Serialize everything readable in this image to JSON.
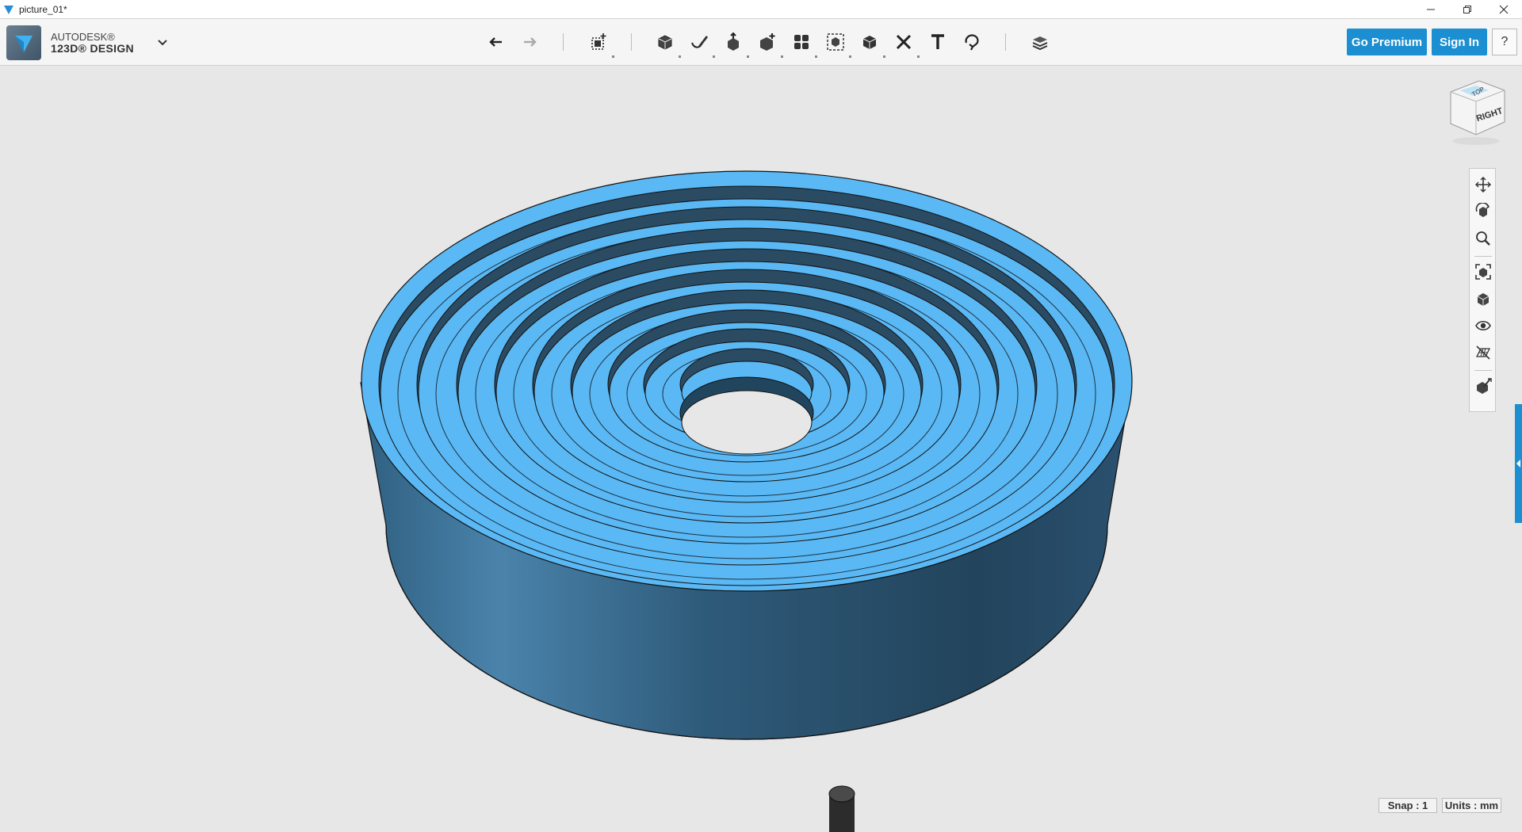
{
  "window": {
    "title": "picture_01*",
    "controls": [
      "minimize",
      "restore",
      "close"
    ]
  },
  "brand": {
    "line1": "AUTODESK®",
    "line2": "123D® DESIGN"
  },
  "toolbar": {
    "tools": [
      {
        "name": "undo-icon"
      },
      {
        "name": "redo-icon"
      },
      {
        "name": "transform-icon"
      },
      {
        "name": "primitives-icon"
      },
      {
        "name": "sketch-icon"
      },
      {
        "name": "construct-icon"
      },
      {
        "name": "modify-icon"
      },
      {
        "name": "pattern-icon"
      },
      {
        "name": "grouping-icon"
      },
      {
        "name": "combine-icon"
      },
      {
        "name": "measure-icon"
      },
      {
        "name": "text-icon"
      },
      {
        "name": "snap-icon"
      },
      {
        "name": "material-icon"
      }
    ],
    "premium_label": "Go Premium",
    "signin_label": "Sign In",
    "help_label": "?"
  },
  "viewcube": {
    "front_label": "RIGHT",
    "top_label": "TOP"
  },
  "navbar": {
    "items": [
      "pan-icon",
      "orbit-icon",
      "zoom-icon",
      "fit-icon",
      "views-icon",
      "visibility-icon",
      "grid-icon",
      "materials-icon"
    ]
  },
  "status": {
    "snap": "Snap : 1",
    "units": "Units : mm"
  },
  "colors": {
    "accent": "#1b8fd1",
    "model_top": "#5ab8f4",
    "model_side": "#3a6f93"
  }
}
